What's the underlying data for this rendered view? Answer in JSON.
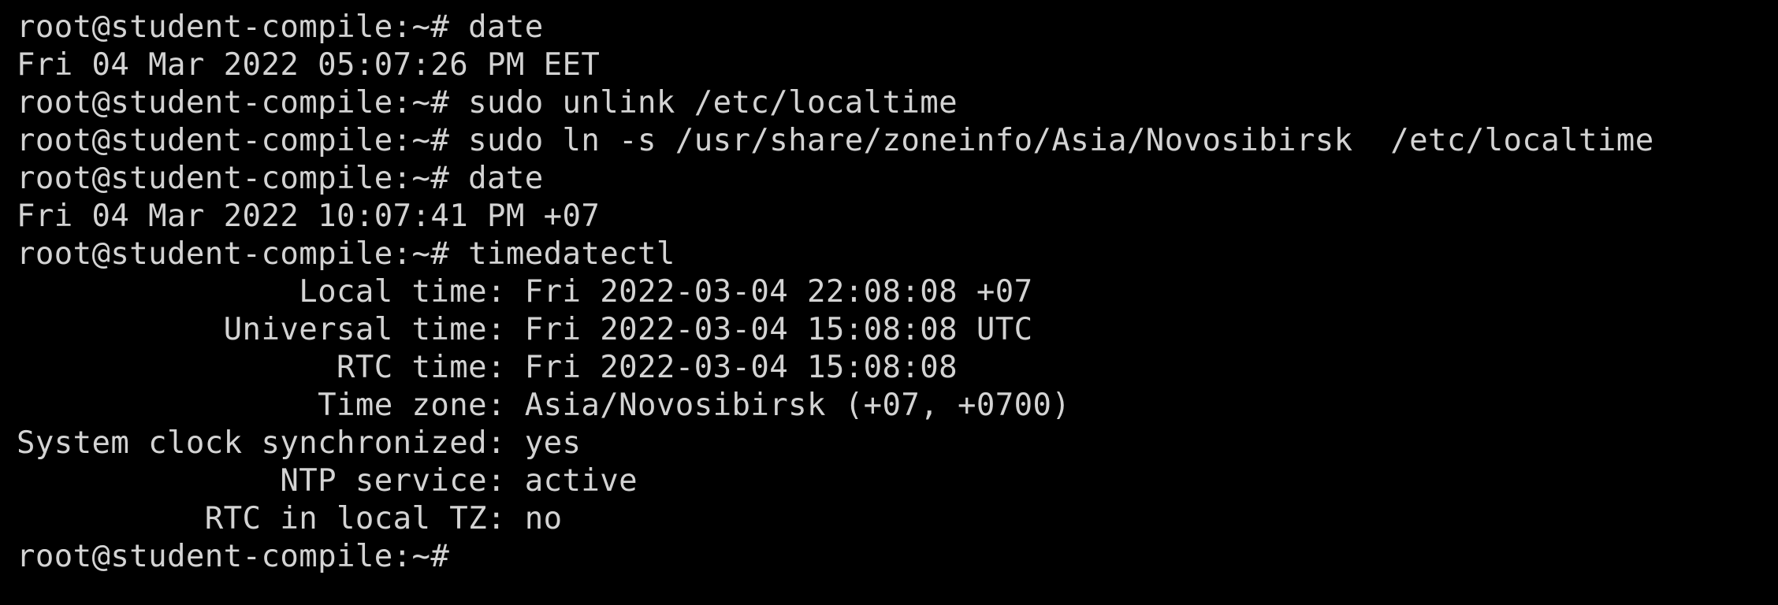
{
  "terminal": {
    "prompt": "root@student-compile:~#",
    "lines": [
      {
        "type": "cmd",
        "text": " date"
      },
      {
        "type": "out",
        "text": "Fri 04 Mar 2022 05:07:26 PM EET"
      },
      {
        "type": "cmd",
        "text": " sudo unlink /etc/localtime"
      },
      {
        "type": "cmd",
        "text": " sudo ln -s /usr/share/zoneinfo/Asia/Novosibirsk  /etc/localtime"
      },
      {
        "type": "cmd",
        "text": " date"
      },
      {
        "type": "out",
        "text": "Fri 04 Mar 2022 10:07:41 PM +07"
      },
      {
        "type": "cmd",
        "text": " timedatectl"
      },
      {
        "type": "kv",
        "key": "               Local time:",
        "val": " Fri 2022-03-04 22:08:08 +07"
      },
      {
        "type": "kv",
        "key": "           Universal time:",
        "val": " Fri 2022-03-04 15:08:08 UTC"
      },
      {
        "type": "kv",
        "key": "                 RTC time:",
        "val": " Fri 2022-03-04 15:08:08"
      },
      {
        "type": "kv",
        "key": "                Time zone:",
        "val": " Asia/Novosibirsk (+07, +0700)"
      },
      {
        "type": "kv",
        "key": "System clock synchronized:",
        "val": " yes"
      },
      {
        "type": "kv",
        "key": "              NTP service:",
        "val": " active"
      },
      {
        "type": "kv",
        "key": "          RTC in local TZ:",
        "val": " no"
      },
      {
        "type": "cmd",
        "text": ""
      }
    ]
  }
}
